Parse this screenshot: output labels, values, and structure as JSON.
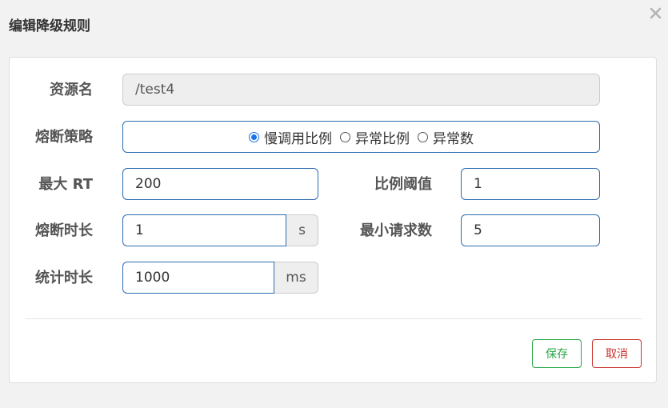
{
  "dialog": {
    "title": "编辑降级规则"
  },
  "icons": {
    "close": "close-icon"
  },
  "form": {
    "resource": {
      "label": "资源名",
      "value": "/test4"
    },
    "strategy": {
      "label": "熔断策略",
      "options": [
        "慢调用比例",
        "异常比例",
        "异常数"
      ],
      "selected": "慢调用比例"
    },
    "max_rt": {
      "label": "最大 RT",
      "value": "200"
    },
    "ratio_threshold": {
      "label": "比例阈值",
      "value": "1"
    },
    "break_duration": {
      "label": "熔断时长",
      "value": "1",
      "unit": "s"
    },
    "min_requests": {
      "label": "最小请求数",
      "value": "5"
    },
    "stat_duration": {
      "label": "统计时长",
      "value": "1000",
      "unit": "ms"
    }
  },
  "buttons": {
    "save": "保存",
    "cancel": "取消"
  },
  "colors": {
    "accent": "#2b6cb0",
    "save": "#28a745",
    "cancel": "#c9302c"
  }
}
